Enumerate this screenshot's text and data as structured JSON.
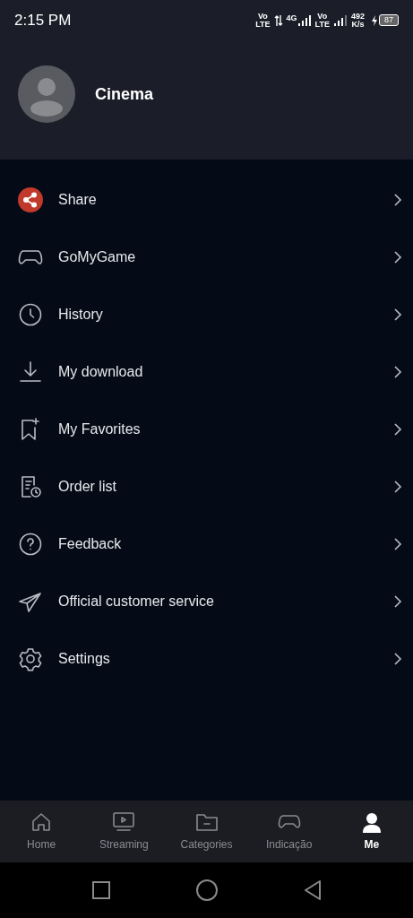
{
  "status_bar": {
    "time": "2:15 PM",
    "indicators": [
      "Vo",
      "LTE",
      "4G",
      "Vo",
      "LTE",
      "492",
      "K/s"
    ],
    "battery": "87"
  },
  "profile": {
    "name": "Cinema"
  },
  "menu": [
    {
      "label": "Share"
    },
    {
      "label": "GoMyGame"
    },
    {
      "label": "History"
    },
    {
      "label": "My download"
    },
    {
      "label": "My Favorites"
    },
    {
      "label": "Order list"
    },
    {
      "label": "Feedback"
    },
    {
      "label": "Official customer service"
    },
    {
      "label": "Settings"
    }
  ],
  "tabs": [
    {
      "label": "Home",
      "selected": false
    },
    {
      "label": "Streaming",
      "selected": false
    },
    {
      "label": "Categories",
      "selected": false
    },
    {
      "label": "Indicação",
      "selected": false
    },
    {
      "label": "Me",
      "selected": true
    }
  ]
}
